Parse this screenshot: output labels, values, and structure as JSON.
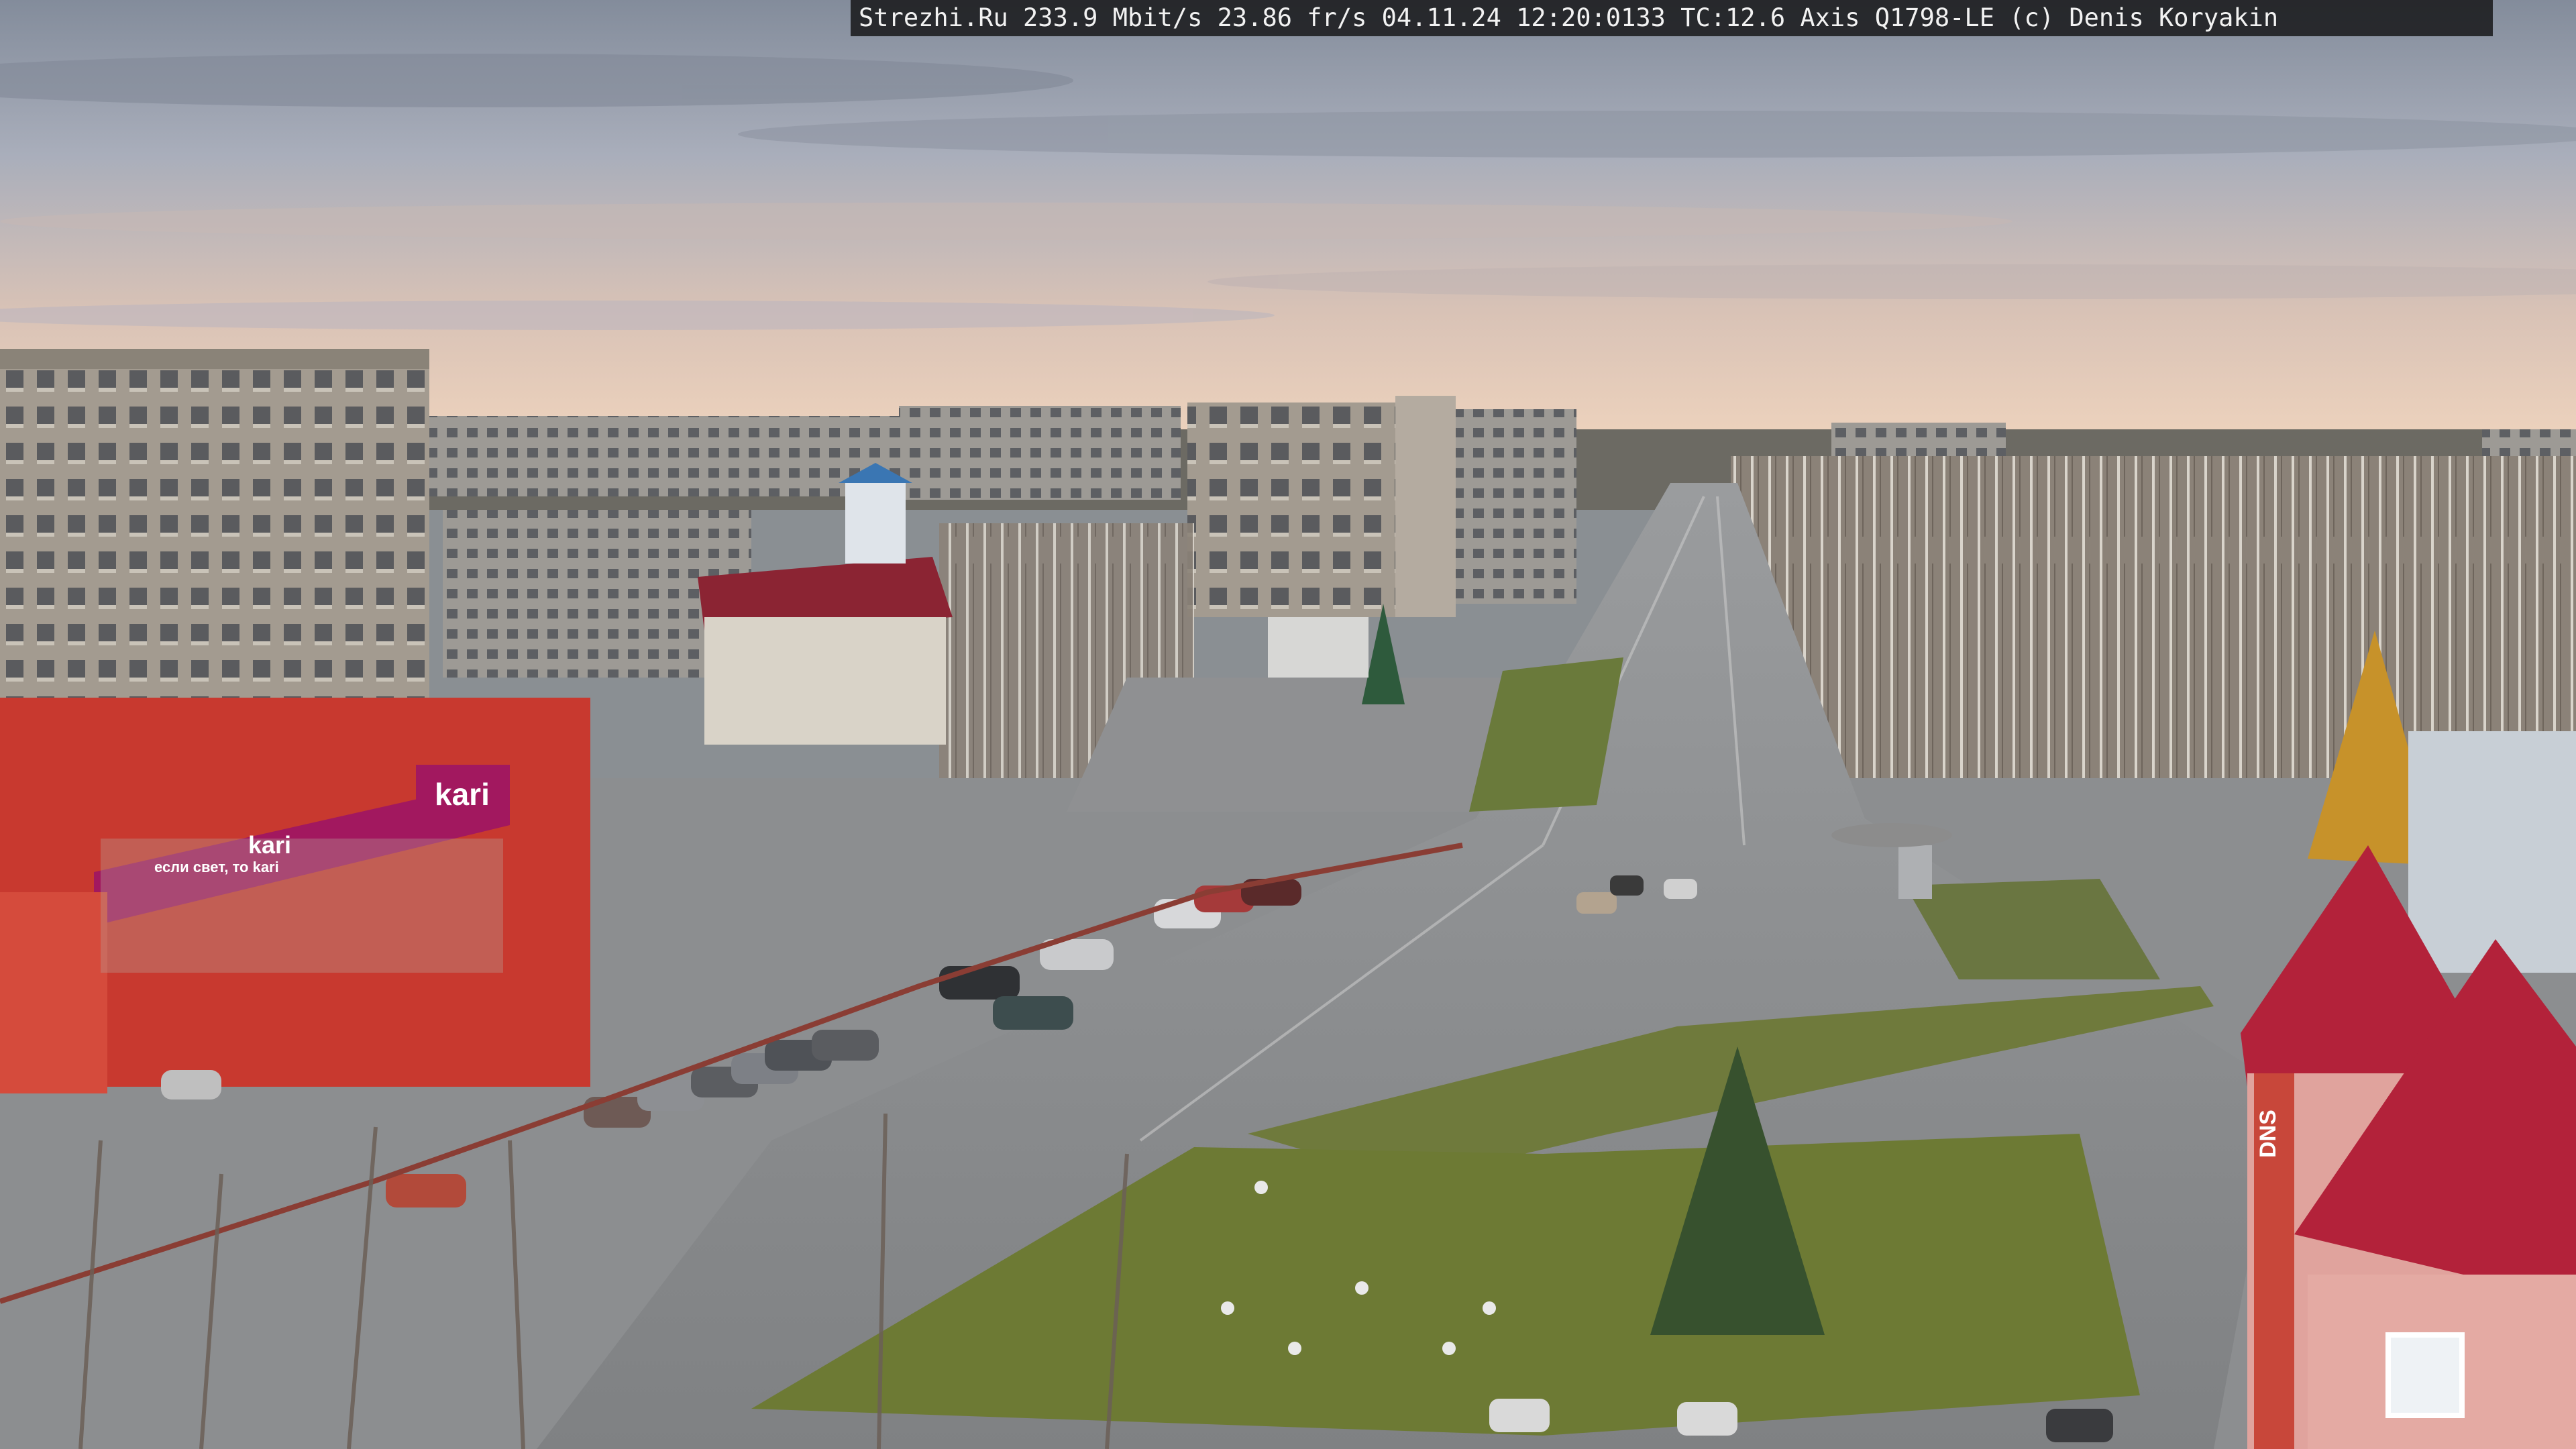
{
  "overlay": {
    "text": "Strezhi.Ru 233.9 Mbit/s 23.86 fr/s 04.11.24 12:20:0133 TC:12.6  Axis Q1798-LE  (c) Denis Koryakin"
  },
  "signs": {
    "kari_large": "kari",
    "kari_small": "kari",
    "kari_slogan": "если свет, то kari",
    "dns": "DNS"
  },
  "colors": {
    "sky_top": "#8d95a3",
    "sky_horizon": "#e7c9b3",
    "asphalt": "#8d8f91",
    "grass": "#6f7a3c",
    "storefront_red": "#c8392f",
    "kari_magenta": "#a2185f",
    "roof_red": "#b3223a",
    "birch_autumn": "#d19a2a"
  }
}
